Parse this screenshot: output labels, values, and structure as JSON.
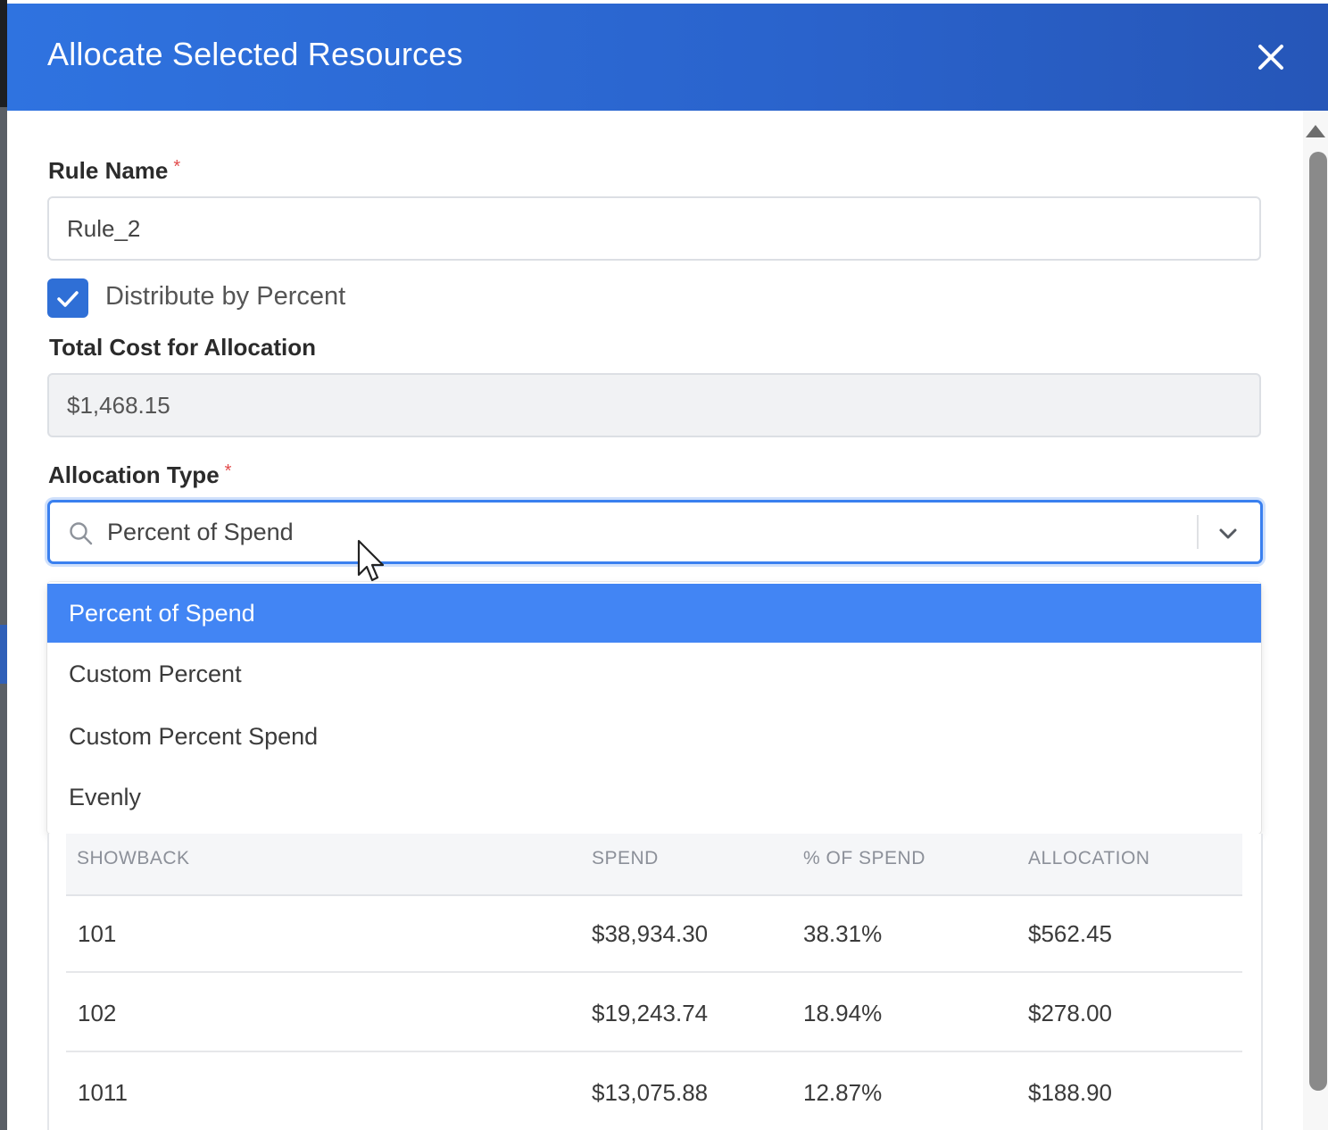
{
  "modal": {
    "title": "Allocate Selected Resources",
    "close_icon": "close-icon"
  },
  "form": {
    "rule_name": {
      "label": "Rule Name",
      "required_marker": "*",
      "value": "Rule_2"
    },
    "distribute": {
      "label": "Distribute by Percent",
      "checked": true
    },
    "total_cost": {
      "label": "Total Cost for Allocation",
      "value": "$1,468.15"
    },
    "allocation_type": {
      "label": "Allocation Type",
      "required_marker": "*",
      "value": "Percent of Spend",
      "options": [
        "Percent of Spend",
        "Custom Percent",
        "Custom Percent Spend",
        "Evenly"
      ]
    }
  },
  "table": {
    "headers": [
      "SHOWBACK",
      "SPEND",
      "% OF SPEND",
      "ALLOCATION"
    ],
    "rows": [
      [
        "101",
        "$38,934.30",
        "38.31%",
        "$562.45"
      ],
      [
        "102",
        "$19,243.74",
        "18.94%",
        "$278.00"
      ],
      [
        "1011",
        "$13,075.88",
        "12.87%",
        "$188.90"
      ]
    ]
  },
  "colors": {
    "header_gradient_start": "#2f73e0",
    "header_gradient_end": "#2656b8",
    "accent": "#2f6fd6",
    "selected_option": "#4285f4",
    "required": "#e24b4b"
  }
}
